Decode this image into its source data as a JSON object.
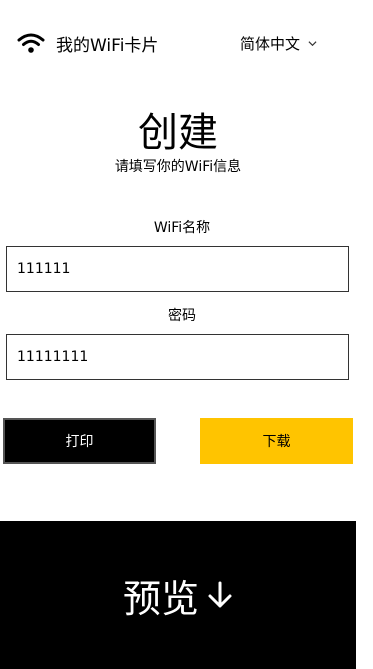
{
  "header": {
    "logo_icon": "wifi-icon",
    "title": "我的WiFi卡片",
    "language": {
      "selected": "简体中文",
      "icon": "chevron-down-icon"
    }
  },
  "form": {
    "title": "创建",
    "subtitle": "请填写你的WiFi信息",
    "ssid": {
      "label": "WiFi名称",
      "value": "111111"
    },
    "password": {
      "label": "密码",
      "value": "11111111"
    }
  },
  "actions": {
    "print_label": "打印",
    "download_label": "下载"
  },
  "preview": {
    "label": "预览",
    "icon": "arrow-down-icon"
  },
  "colors": {
    "accent": "#ffc400",
    "dark": "#000000",
    "background": "#ffffff"
  }
}
